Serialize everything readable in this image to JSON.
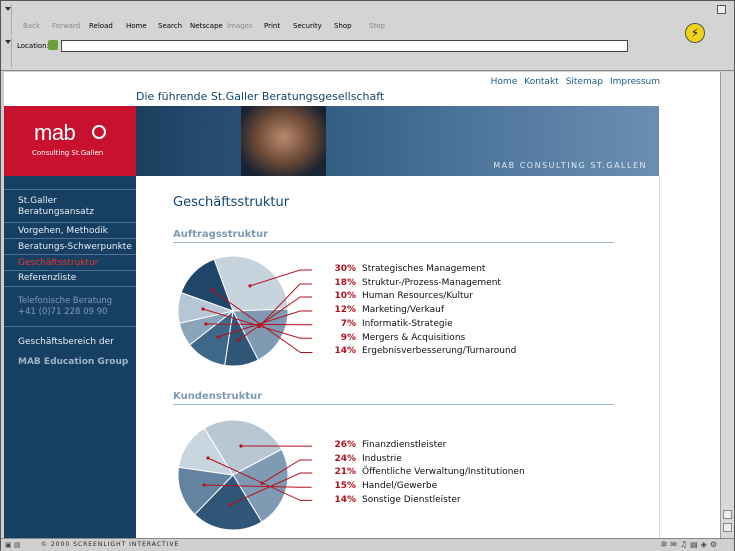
{
  "browser": {
    "toolbar_buttons": [
      {
        "label": "Back",
        "enabled": false
      },
      {
        "label": "Forward",
        "enabled": false
      },
      {
        "label": "Reload",
        "enabled": true
      },
      {
        "label": "Home",
        "enabled": true
      },
      {
        "label": "Search",
        "enabled": true
      },
      {
        "label": "Netscape",
        "enabled": true
      },
      {
        "label": "Images",
        "enabled": false
      },
      {
        "label": "Print",
        "enabled": true
      },
      {
        "label": "Security",
        "enabled": true
      },
      {
        "label": "Shop",
        "enabled": true
      },
      {
        "label": "Stop",
        "enabled": false
      }
    ],
    "location_label": "Location:",
    "location_value": "",
    "status_text": "© 2000 SCREENLIGHT INTERACTIVE"
  },
  "site": {
    "topnav": [
      "Home",
      "Kontakt",
      "Sitemap",
      "Impressum"
    ],
    "tagline": "Die führende St.Galler Beratungsgesellschaft",
    "logo_text": "mab",
    "logo_sub": "Consulting St.Gallen",
    "banner_caption": "MAB CONSULTING ST.GALLEN",
    "sidebar": {
      "items": [
        "St.Galler\nBeratungsansatz",
        "Vorgehen, Methodik",
        "Beratungs-Schwerpunkte",
        "Geschäftsstruktur",
        "Referenzliste"
      ],
      "active_index": 3,
      "phone_label": "Telefonische Beratung",
      "phone_number": "+41 (0)71 228 09 90",
      "group_label": "Geschäftsbereich der",
      "group_name": "MAB Education Group"
    }
  },
  "main": {
    "title": "Geschäftsstruktur",
    "sections": [
      {
        "heading": "Auftragsstruktur",
        "rows": [
          {
            "pct": "30%",
            "label": "Strategisches Management",
            "value": 30
          },
          {
            "pct": "18%",
            "label": "Struktur-/Prozess-Management",
            "value": 18
          },
          {
            "pct": "10%",
            "label": "Human Resources/Kultur",
            "value": 10
          },
          {
            "pct": "12%",
            "label": "Marketing/Verkauf",
            "value": 12
          },
          {
            "pct": "7%",
            "label": "Informatik-Strategie",
            "value": 7
          },
          {
            "pct": "9%",
            "label": "Mergers & Acquisitions",
            "value": 9
          },
          {
            "pct": "14%",
            "label": "Ergebnisverbesserung/Turnaround",
            "value": 14
          }
        ]
      },
      {
        "heading": "Kundenstruktur",
        "rows": [
          {
            "pct": "26%",
            "label": "Finanzdienstleister",
            "value": 26
          },
          {
            "pct": "24%",
            "label": "Industrie",
            "value": 24
          },
          {
            "pct": "21%",
            "label": "Öffentliche Verwaltung/Institutionen",
            "value": 21
          },
          {
            "pct": "15%",
            "label": "Handel/Gewerbe",
            "value": 15
          },
          {
            "pct": "14%",
            "label": "Sonstige Dienstleister",
            "value": 14
          }
        ]
      }
    ]
  },
  "colors": {
    "navy": "#173f62",
    "red": "#c8112e",
    "accent_red": "#b3121f",
    "pie_shades": [
      "#c7d3dd",
      "#7f9ab2",
      "#2f5577",
      "#3f6788",
      "#8aa4ba",
      "#b6c6d4",
      "#1f4668"
    ]
  },
  "chart_data": [
    {
      "type": "pie",
      "title": "Auftragsstruktur",
      "categories": [
        "Strategisches Management",
        "Struktur-/Prozess-Management",
        "Human Resources/Kultur",
        "Marketing/Verkauf",
        "Informatik-Strategie",
        "Mergers & Acquisitions",
        "Ergebnisverbesserung/Turnaround"
      ],
      "values": [
        30,
        18,
        10,
        12,
        7,
        9,
        14
      ]
    },
    {
      "type": "pie",
      "title": "Kundenstruktur",
      "categories": [
        "Finanzdienstleister",
        "Industrie",
        "Öffentliche Verwaltung/Institutionen",
        "Handel/Gewerbe",
        "Sonstige Dienstleister"
      ],
      "values": [
        26,
        24,
        21,
        15,
        14
      ]
    }
  ]
}
